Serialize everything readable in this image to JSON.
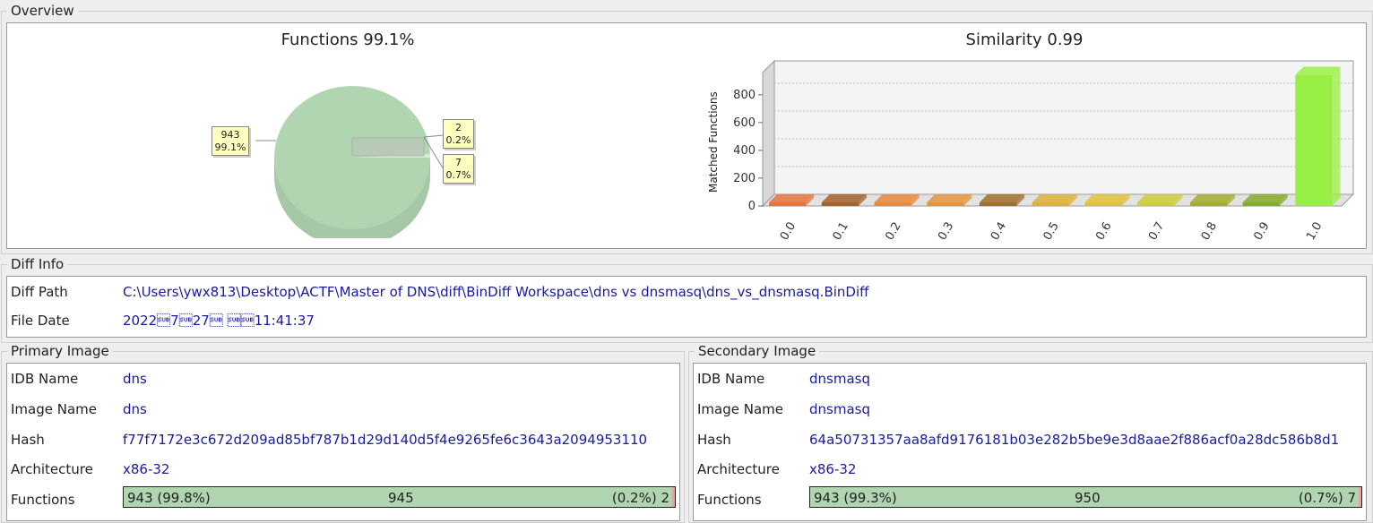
{
  "overview": {
    "title": "Overview",
    "pie": {
      "title": "Functions 99.1%",
      "callouts": [
        {
          "count": "943",
          "pct": "99.1%"
        },
        {
          "count": "2",
          "pct": "0.2%"
        },
        {
          "count": "7",
          "pct": "0.7%"
        }
      ]
    },
    "bar": {
      "title": "Similarity 0.99",
      "ylabel": "Matched Functions"
    }
  },
  "chart_data": [
    {
      "type": "pie",
      "title": "Functions 99.1%",
      "slices": [
        {
          "label": "943",
          "value": 943,
          "pct": "99.1%",
          "color": "#b1d4b1"
        },
        {
          "label": "2",
          "value": 2,
          "pct": "0.2%",
          "color": "#dfe7df"
        },
        {
          "label": "7",
          "value": 7,
          "pct": "0.7%",
          "color": "#b6c7b6"
        }
      ]
    },
    {
      "type": "bar",
      "title": "Similarity 0.99",
      "ylabel": "Matched Functions",
      "xlabel": "",
      "categories": [
        "0.0",
        "0.1",
        "0.2",
        "0.3",
        "0.4",
        "0.5",
        "0.6",
        "0.7",
        "0.8",
        "0.9",
        "1.0"
      ],
      "values": [
        0,
        0,
        0,
        0,
        0,
        0,
        0,
        0,
        0,
        0,
        943
      ],
      "colors": [
        "#e8743b",
        "#a0632e",
        "#e88a3a",
        "#e6953d",
        "#a06f2e",
        "#ddb13a",
        "#e0c23a",
        "#cfcd3a",
        "#a3ad2e",
        "#86ad2a",
        "#99ee44"
      ],
      "yticks": [
        0,
        200,
        400,
        600,
        800
      ],
      "ylim": [
        0,
        960
      ],
      "grid": true
    }
  ],
  "diff_info": {
    "title": "Diff Info",
    "diff_path_label": "Diff Path",
    "diff_path": "C:\\Users\\ywx813\\Desktop\\ACTF\\Master of DNS\\diff\\BinDiff Workspace\\dns vs dnsmasq\\dns_vs_dnsmasq.BinDiff",
    "file_date_label": "File Date",
    "file_date": "2022\u001a7\u001a27\u001a \u001a\u001a11:41:37"
  },
  "primary": {
    "title": "Primary Image",
    "idb_label": "IDB Name",
    "idb": "dns",
    "image_label": "Image Name",
    "image": "dns",
    "hash_label": "Hash",
    "hash": "f77f7172e3c672d209ad85bf787b1d29d140d5f4e9265fe6c3643a2094953110",
    "arch_label": "Architecture",
    "arch": "x86-32",
    "functions_label": "Functions",
    "functions_left": "943 (99.8%)",
    "functions_total": "945",
    "functions_right": "(0.2%) 2"
  },
  "secondary": {
    "title": "Secondary Image",
    "idb_label": "IDB Name",
    "idb": "dnsmasq",
    "image_label": "Image Name",
    "image": "dnsmasq",
    "hash_label": "Hash",
    "hash": "64a50731357aa8afd9176181b03e282b5be9e3d8aae2f886acf0a28dc586b8d1",
    "arch_label": "Architecture",
    "arch": "x86-32",
    "functions_label": "Functions",
    "functions_left": "943 (99.3%)",
    "functions_total": "950",
    "functions_right": "(0.7%) 7"
  }
}
